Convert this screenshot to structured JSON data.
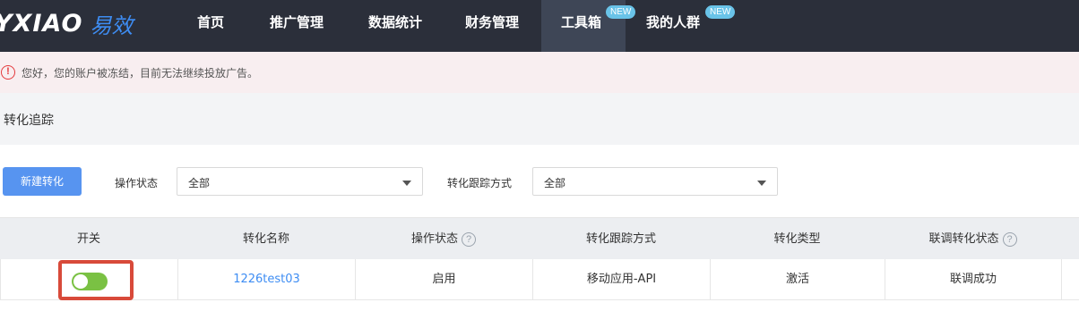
{
  "brand": {
    "logo_en": "YXIAO",
    "logo_cn": "易效"
  },
  "nav": {
    "items": [
      {
        "label": "首页"
      },
      {
        "label": "推广管理"
      },
      {
        "label": "数据统计"
      },
      {
        "label": "财务管理"
      },
      {
        "label": "工具箱",
        "badge": "NEW",
        "active": true
      },
      {
        "label": "我的人群",
        "badge": "NEW"
      }
    ]
  },
  "alert": {
    "icon": "exclamation-circle-icon",
    "text": "您好，您的账户被冻结，目前无法继续投放广告。"
  },
  "page_title": "转化追踪",
  "toolbar": {
    "new_button": "新建转化",
    "filters": [
      {
        "label": "操作状态",
        "value": "全部"
      },
      {
        "label": "转化跟踪方式",
        "value": "全部"
      }
    ]
  },
  "table": {
    "columns": [
      {
        "label": "开关"
      },
      {
        "label": "转化名称"
      },
      {
        "label": "操作状态",
        "help": "?"
      },
      {
        "label": "转化跟踪方式"
      },
      {
        "label": "转化类型"
      },
      {
        "label": "联调转化状态",
        "help": "?"
      }
    ],
    "rows": [
      {
        "switch_on": true,
        "name": "1226test03",
        "status": "启用",
        "tracking": "移动应用-API",
        "type": "激活",
        "debug_status": "联调成功"
      }
    ]
  },
  "colors": {
    "nav_bg": "#2b2f3a",
    "accent": "#3e8df3",
    "toggle_on": "#7ac143",
    "highlight": "#d84a3a",
    "alert_bg": "#f8eef0"
  }
}
